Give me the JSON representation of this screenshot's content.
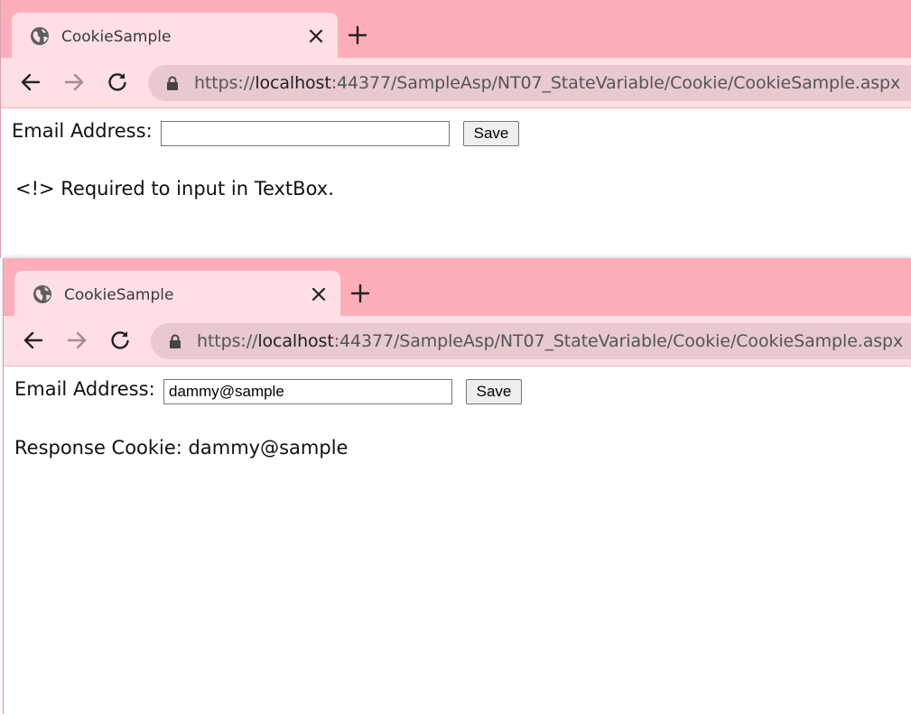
{
  "windows": [
    {
      "tab_title": "CookieSample",
      "url": {
        "scheme": "https://",
        "host": "localhost",
        "rest": ":44377/SampleAsp/NT07_StateVariable/Cookie/CookieSample.aspx"
      },
      "form": {
        "label": "Email Address:",
        "value": "",
        "save_label": "Save"
      },
      "message": "<!> Required to input in TextBox."
    },
    {
      "tab_title": "CookieSample",
      "url": {
        "scheme": "https://",
        "host": "localhost",
        "rest": ":44377/SampleAsp/NT07_StateVariable/Cookie/CookieSample.aspx"
      },
      "form": {
        "label": "Email Address:",
        "value": "dammy@sample",
        "save_label": "Save"
      },
      "message": "Response Cookie: dammy@sample"
    }
  ],
  "icons": {
    "tab_icon": "globe-icon",
    "close": "close-icon",
    "new_tab": "plus-icon",
    "back": "arrow-left-icon",
    "forward": "arrow-right-icon",
    "reload": "reload-icon",
    "lock": "lock-icon"
  },
  "colors": {
    "tabstrip": "#feadba",
    "active_tab": "#fddfe4",
    "omnibox": "#e8c9d0"
  }
}
